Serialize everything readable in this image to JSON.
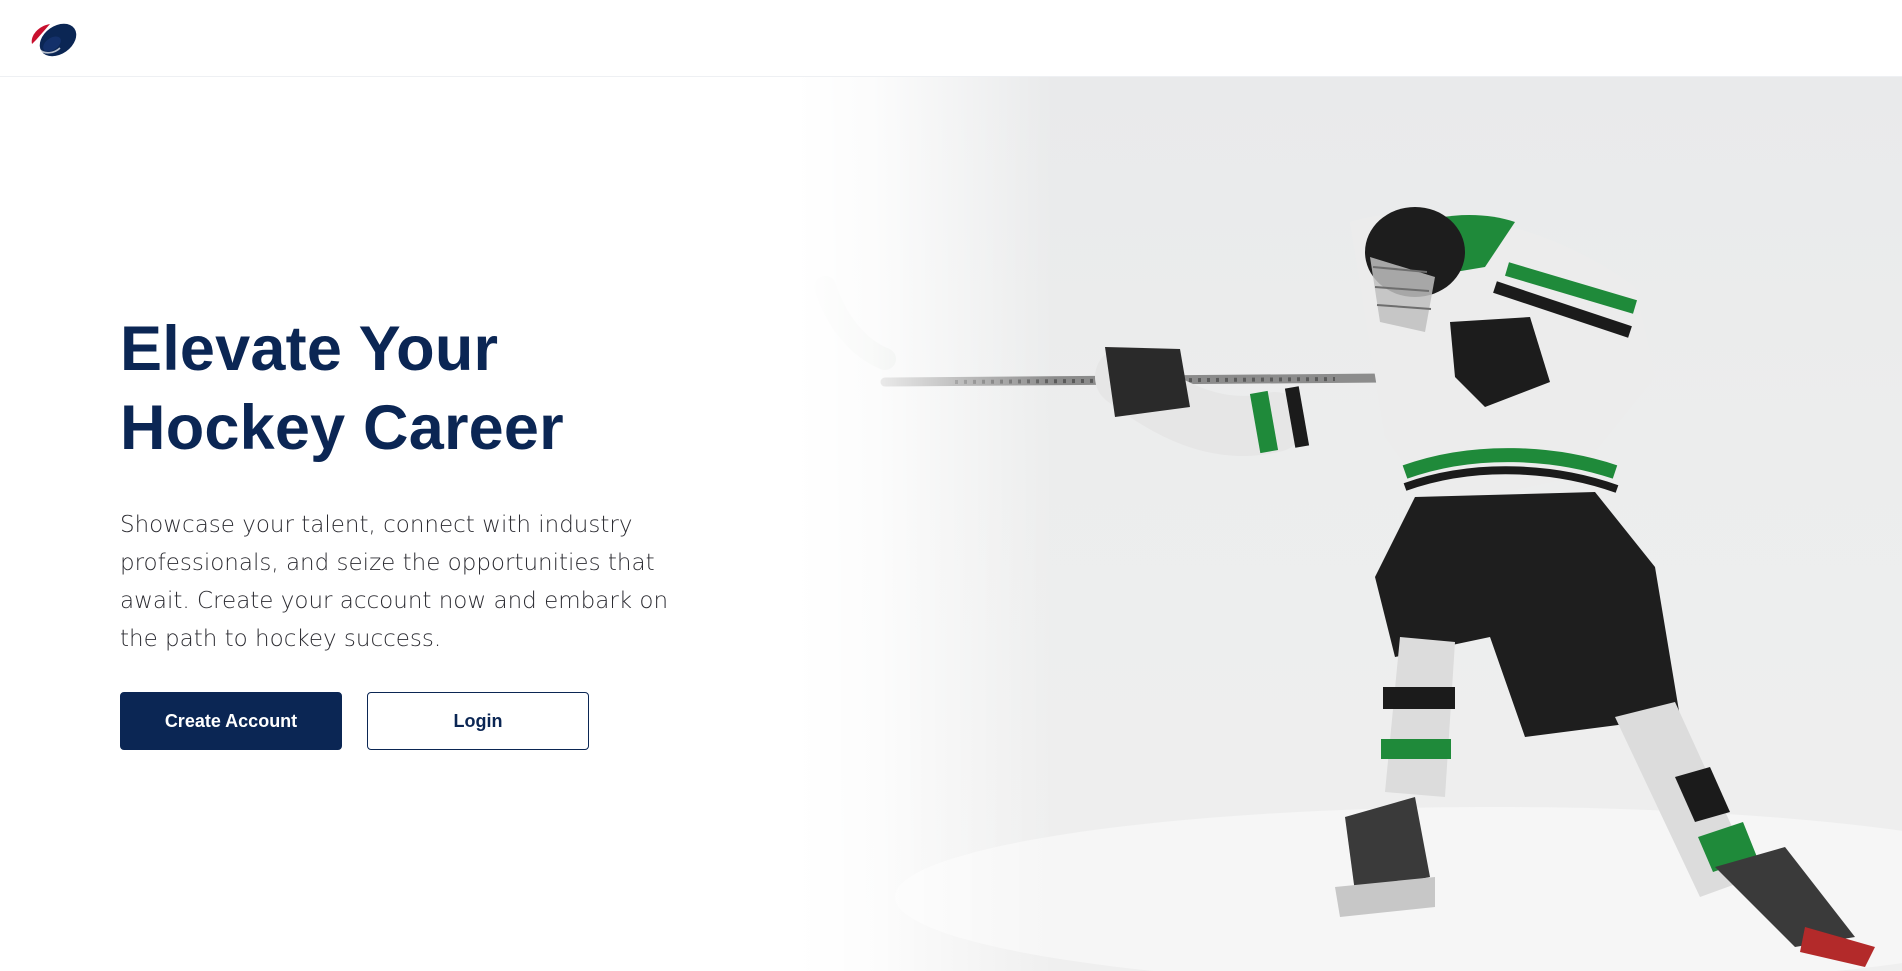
{
  "header": {
    "logo_icon": "hockey-puck-logo-icon",
    "brand_color": "#0b2654",
    "accent_color": "#c8102e"
  },
  "hero": {
    "title_line1": "Elevate Your",
    "title_line2": "Hockey Career",
    "description": "Showcase your talent, connect with industry professionals, and seize the opportunities that await. Create your account now and embark on the path to hockey success.",
    "create_account_label": "Create Account",
    "login_label": "Login",
    "image_subject": "hockey-player-photo"
  }
}
